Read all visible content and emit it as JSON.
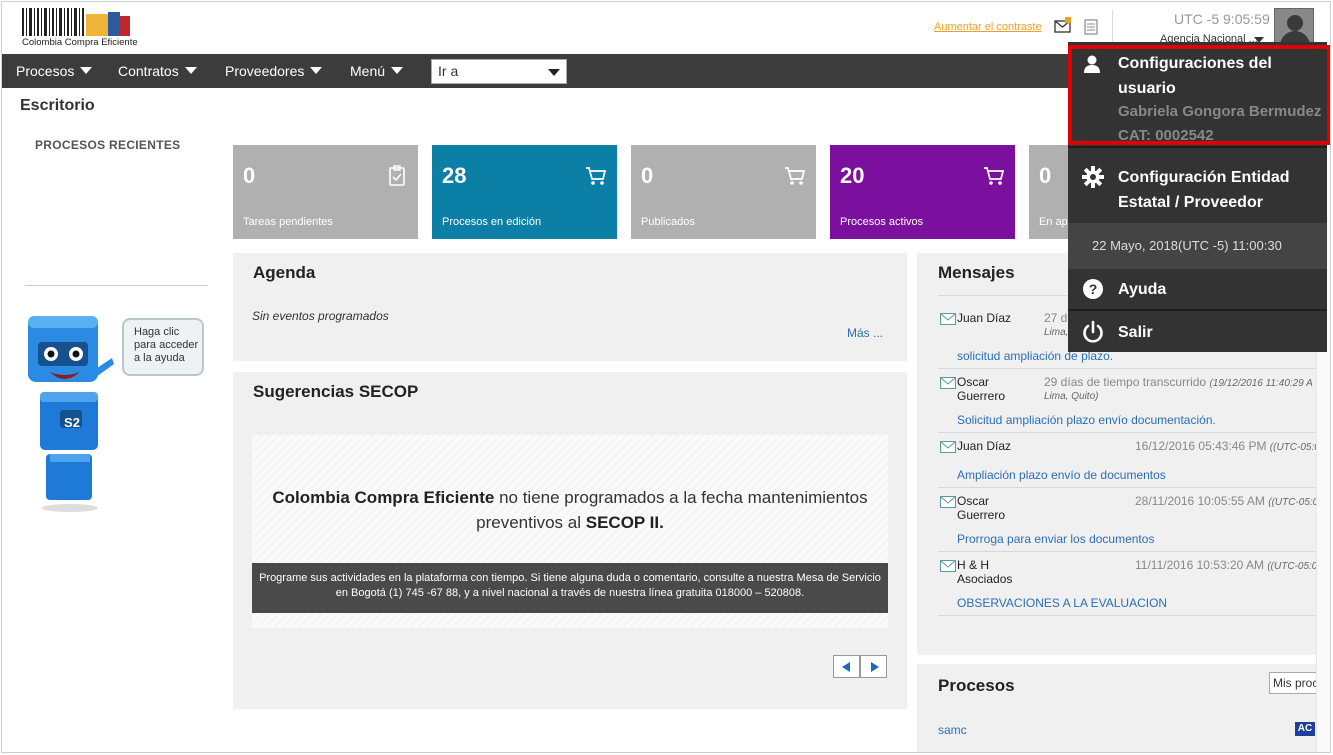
{
  "header": {
    "logo_text": "Colombia Compra Eficiente",
    "contrast_link": "Aumentar el contraste",
    "utc_label": "UTC -5",
    "utc_time": "9:05:59",
    "agency": "Agencia Nacional ..."
  },
  "navbar": {
    "items": [
      {
        "label": "Procesos"
      },
      {
        "label": "Contratos"
      },
      {
        "label": "Proveedores"
      },
      {
        "label": "Menú"
      }
    ],
    "goto_value": "Ir a"
  },
  "page": {
    "title": "Escritorio",
    "recent_title": "PROCESOS RECIENTES",
    "help_bubble": "Haga clic para acceder a la ayuda",
    "robot_badge": "S2"
  },
  "tiles": [
    {
      "value": "0",
      "label": "Tareas pendientes",
      "color": "#b0b0b0",
      "icon": "clipboard-check-icon"
    },
    {
      "value": "28",
      "label": "Procesos en edición",
      "color": "#0b7fa6",
      "icon": "cart-icon"
    },
    {
      "value": "0",
      "label": "Publicados",
      "color": "#b0b0b0",
      "icon": "cart-icon"
    },
    {
      "value": "20",
      "label": "Procesos activos",
      "color": "#7b0f9e",
      "icon": "cart-icon"
    },
    {
      "value": "0",
      "label": "En ap",
      "color": "#b0b0b0",
      "icon": "cart-icon"
    }
  ],
  "agenda": {
    "title": "Agenda",
    "empty_text": "Sin eventos programados",
    "more": "Más ..."
  },
  "suggestions": {
    "title": "Sugerencias SECOP",
    "headline_bold1": "Colombia Compra Eficiente",
    "headline_mid": " no tiene programados a la fecha mantenimientos preventivos al ",
    "headline_bold2": "SECOP II.",
    "bar_text": "Programe sus actividades en la plataforma con tiempo. Si tiene alguna duda o comentario, consulte a nuestra Mesa de Servicio en Bogotá (1) 745 -67 88, y a nivel nacional a través de nuestra línea gratuita 018000 – 520808."
  },
  "messages": {
    "title": "Mensajes",
    "items": [
      {
        "sender": "Juan Díaz",
        "time": "27 d",
        "time_extra": "",
        "location": "Lima,",
        "subject": "solicitud ampliación de plazo."
      },
      {
        "sender": "Oscar Guerrero",
        "time": "29 días de tiempo transcurrido",
        "time_extra": "(19/12/2016 11:40:29 A",
        "location": "Lima, Quito)",
        "subject": "Solicitud ampliación plazo envío documentación."
      },
      {
        "sender": "Juan Díaz",
        "time": "16/12/2016 05:43:46 PM",
        "time_extra": "((UTC-05:0",
        "location": "",
        "subject": "Ampliación plazo envío de documentos"
      },
      {
        "sender": "Oscar Guerrero",
        "time": "28/11/2016 10:05:55 AM",
        "time_extra": "((UTC-05:0",
        "location": "",
        "subject": "Prorroga para enviar los documentos"
      },
      {
        "sender": "H & H Asociados",
        "time": "11/11/2016 10:53:20 AM",
        "time_extra": "((UTC-05:0",
        "location": "",
        "subject": "OBSERVACIONES A LA EVALUACION"
      }
    ]
  },
  "processes": {
    "title": "Procesos",
    "filter_button": "Mis proc",
    "first_item": "samc",
    "first_badge": "AC"
  },
  "user_menu": {
    "user_settings_label": "Configuraciones del usuario",
    "user_name": "Gabriela Gongora Bermudez",
    "user_cat": "CAT: 0002542",
    "entity_settings_label": "Configuración Entidad Estatal / Proveedor",
    "date_text": "22 Mayo, 2018(UTC -5) 11:00:30",
    "help_label": "Ayuda",
    "logout_label": "Salir",
    "highlight_color": "#e00000"
  }
}
